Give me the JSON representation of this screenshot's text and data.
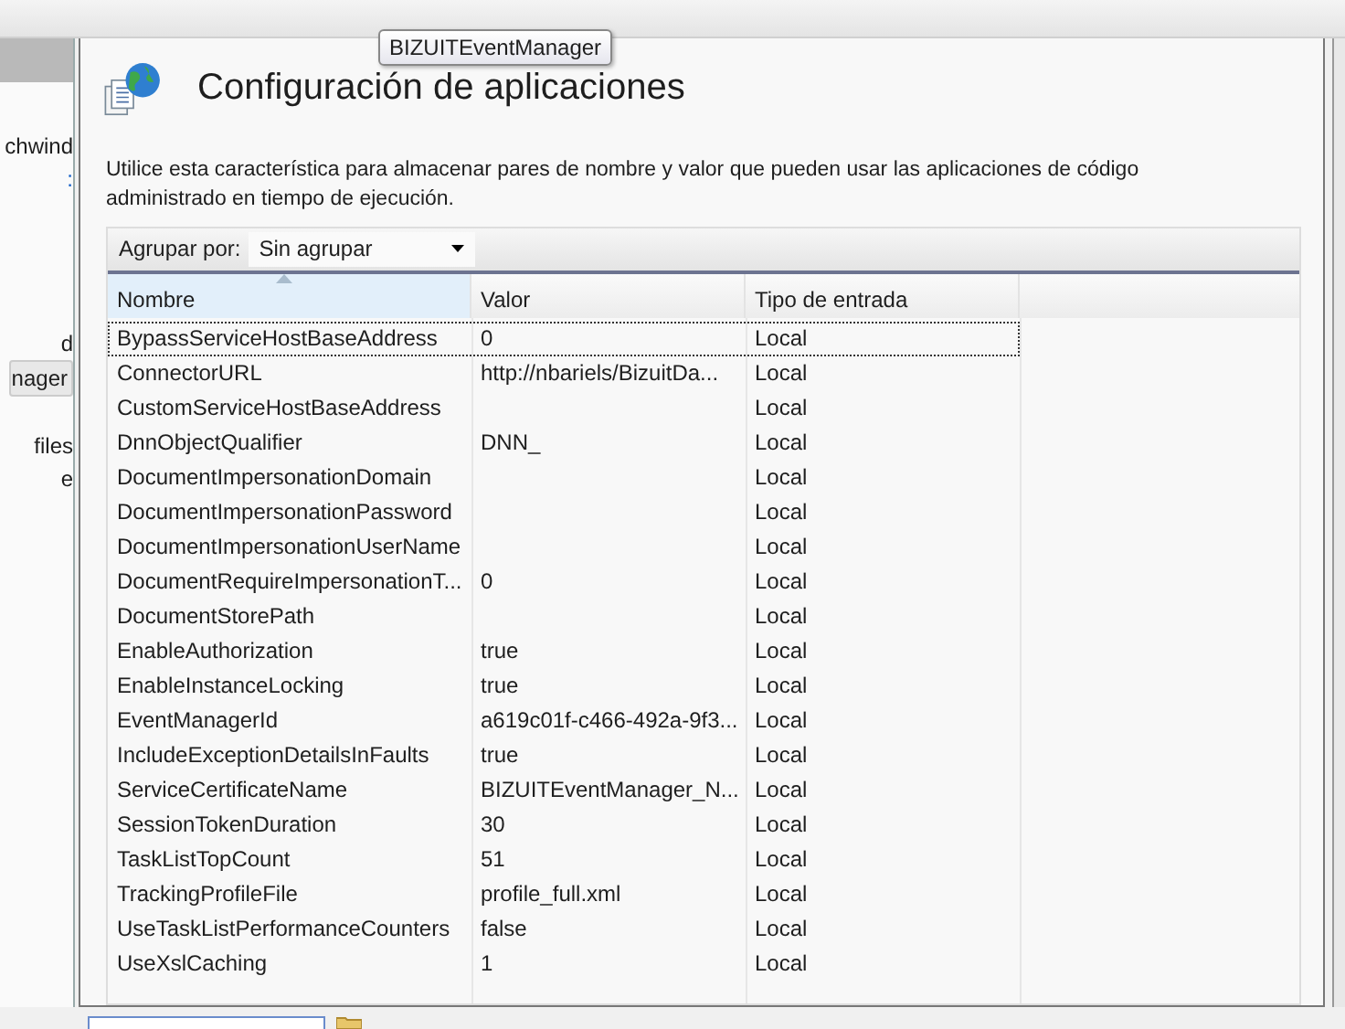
{
  "tooltip": "BIZUITEventManager",
  "sidebar": {
    "items": [
      {
        "label": "chwind",
        "link": false,
        "selected": false
      },
      {
        "label": ":",
        "link": true,
        "selected": false
      },
      {
        "label": "d",
        "link": false,
        "selected": false
      },
      {
        "label": "nager",
        "link": false,
        "selected": true
      },
      {
        "label": "files",
        "link": false,
        "selected": false
      },
      {
        "label": "e",
        "link": false,
        "selected": false
      }
    ]
  },
  "page": {
    "title": "Configuración de aplicaciones",
    "description": "Utilice esta característica para almacenar pares de nombre y valor que pueden usar las aplicaciones de código administrado en tiempo de ejecución."
  },
  "group_by": {
    "label": "Agrupar por:",
    "value": "Sin agrupar"
  },
  "table": {
    "columns": [
      {
        "label": "Nombre",
        "sorted": true
      },
      {
        "label": "Valor",
        "sorted": false
      },
      {
        "label": "Tipo de entrada",
        "sorted": false
      }
    ],
    "rows": [
      {
        "name": "BypassServiceHostBaseAddress",
        "value": "0",
        "type": "Local",
        "selected": true
      },
      {
        "name": "ConnectorURL",
        "value": "http://nbariels/BizuitDa...",
        "type": "Local",
        "selected": false
      },
      {
        "name": "CustomServiceHostBaseAddress",
        "value": "",
        "type": "Local",
        "selected": false
      },
      {
        "name": "DnnObjectQualifier",
        "value": "DNN_",
        "type": "Local",
        "selected": false
      },
      {
        "name": "DocumentImpersonationDomain",
        "value": "",
        "type": "Local",
        "selected": false
      },
      {
        "name": "DocumentImpersonationPassword",
        "value": "",
        "type": "Local",
        "selected": false
      },
      {
        "name": "DocumentImpersonationUserName",
        "value": "",
        "type": "Local",
        "selected": false
      },
      {
        "name": "DocumentRequireImpersonationT...",
        "value": "0",
        "type": "Local",
        "selected": false
      },
      {
        "name": "DocumentStorePath",
        "value": "",
        "type": "Local",
        "selected": false
      },
      {
        "name": "EnableAuthorization",
        "value": "true",
        "type": "Local",
        "selected": false
      },
      {
        "name": "EnableInstanceLocking",
        "value": "true",
        "type": "Local",
        "selected": false
      },
      {
        "name": "EventManagerId",
        "value": "a619c01f-c466-492a-9f3...",
        "type": "Local",
        "selected": false
      },
      {
        "name": "IncludeExceptionDetailsInFaults",
        "value": "true",
        "type": "Local",
        "selected": false
      },
      {
        "name": "ServiceCertificateName",
        "value": "BIZUITEventManager_N...",
        "type": "Local",
        "selected": false
      },
      {
        "name": "SessionTokenDuration",
        "value": "30",
        "type": "Local",
        "selected": false
      },
      {
        "name": "TaskListTopCount",
        "value": "51",
        "type": "Local",
        "selected": false
      },
      {
        "name": "TrackingProfileFile",
        "value": "profile_full.xml",
        "type": "Local",
        "selected": false
      },
      {
        "name": "UseTaskListPerformanceCounters",
        "value": "false",
        "type": "Local",
        "selected": false
      },
      {
        "name": "UseXslCaching",
        "value": "1",
        "type": "Local",
        "selected": false
      }
    ]
  }
}
